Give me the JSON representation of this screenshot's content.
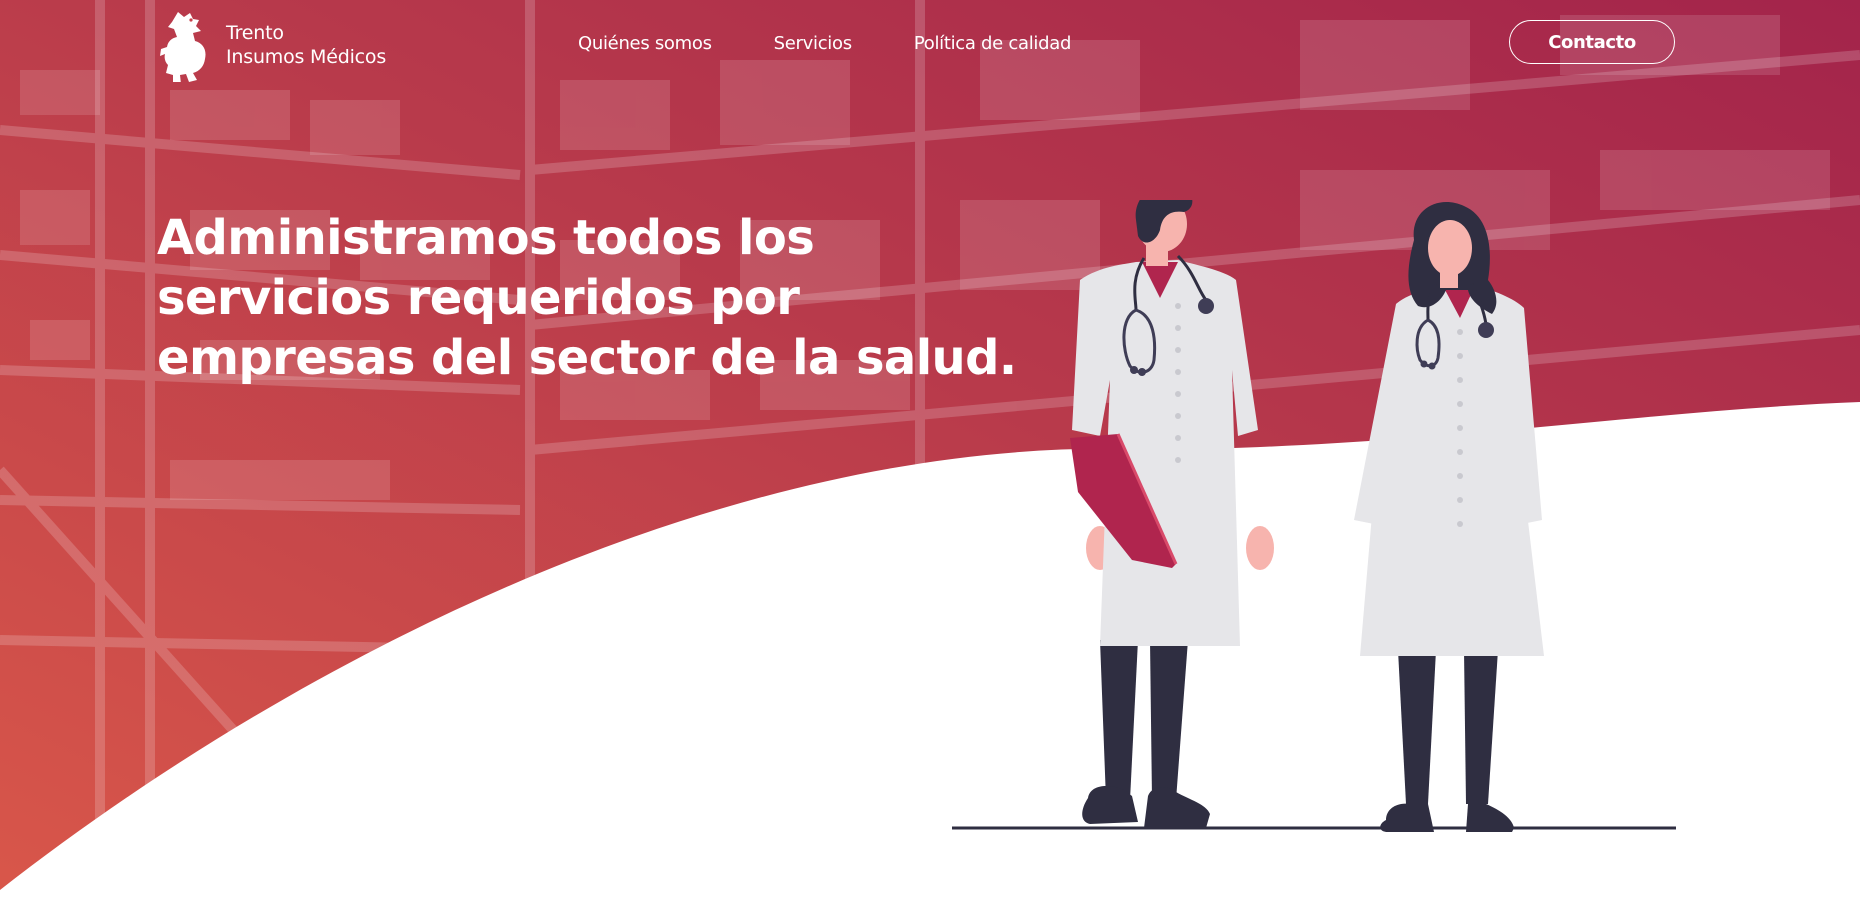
{
  "brand": {
    "name_line1": "Trento",
    "name_line2": "Insumos Médicos",
    "logo_icon": "rampant-lion-icon"
  },
  "nav": {
    "items": [
      "Quiénes somos",
      "Servicios",
      "Política de calidad"
    ]
  },
  "contact": {
    "label": "Contacto"
  },
  "hero": {
    "headline_lines": [
      "Administramos todos los",
      "servicios requeridos por",
      "empresas del sector de la salud."
    ],
    "illustration": "two-doctors-illustration"
  },
  "colors": {
    "overlay_start": "#d9574a",
    "overlay_end": "#a6264b",
    "accent": "#b0254e",
    "coat": "#e6e6e9",
    "dark": "#2f2e41",
    "skin": "#f7b4ae"
  }
}
